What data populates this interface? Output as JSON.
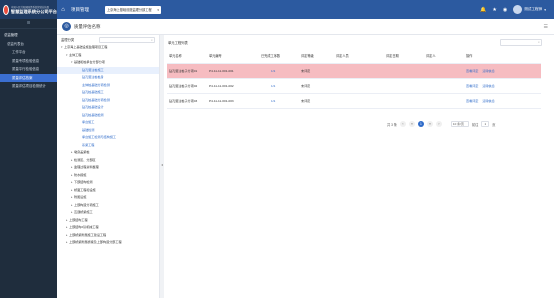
{
  "brand": {
    "subtitle": "中国人民共和国国资委监管营业执照",
    "title": "智慧监理系统分公司平台"
  },
  "sidebar": {
    "collapse_icon": "collapse-icon",
    "items": [
      {
        "label": "总监管理",
        "level": "l1"
      },
      {
        "label": "总监代表台",
        "level": "l2"
      },
      {
        "label": "工作平台",
        "level": "l3"
      },
      {
        "label": "质量专项检验信息",
        "level": "l3"
      },
      {
        "label": "质量平行检验信息",
        "level": "l3"
      },
      {
        "label": "质量评估档案",
        "level": "l3",
        "active": true
      },
      {
        "label": "质量评估项目检测统计",
        "level": "l3"
      }
    ]
  },
  "topbar": {
    "title": "项目管理",
    "project": "上京海上基础设施监理分部工程"
  },
  "page": {
    "title": "质量评估名称"
  },
  "tree": {
    "label": "监理分类",
    "nodes": [
      {
        "text": "上京海上基础设施监理项目工程",
        "indent": 4,
        "caret": "▾"
      },
      {
        "text": "主体工程",
        "indent": 9,
        "caret": "▾"
      },
      {
        "text": "基础和桩承台分部分项",
        "indent": 14,
        "caret": "▾"
      },
      {
        "text": "钻孔灌注桩施工",
        "indent": 22,
        "caret": "",
        "link": true,
        "selected": true
      },
      {
        "text": "钻孔灌注桩桩身",
        "indent": 22,
        "caret": "",
        "link": true
      },
      {
        "text": "主体桩基础分项检测",
        "indent": 22,
        "caret": "",
        "link": true
      },
      {
        "text": "钻孔桩基础施工",
        "indent": 22,
        "caret": "",
        "link": true
      },
      {
        "text": "钻孔桩基础分项检测",
        "indent": 22,
        "caret": "",
        "link": true
      },
      {
        "text": "钻孔桩基础设计",
        "indent": 22,
        "caret": "",
        "link": true
      },
      {
        "text": "钻孔桩基础检测",
        "indent": 22,
        "caret": "",
        "link": true
      },
      {
        "text": "承台施工",
        "indent": 22,
        "caret": "",
        "link": true
      },
      {
        "text": "基础检测",
        "indent": 22,
        "caret": "",
        "link": true
      },
      {
        "text": "承台施工检测与结构施工",
        "indent": 22,
        "caret": "",
        "link": true
      },
      {
        "text": "系梁工程",
        "indent": 22,
        "caret": "",
        "link": true
      },
      {
        "text": "墩身盖梁桩",
        "indent": 14,
        "caret": "▸"
      },
      {
        "text": "检测区、分部区",
        "indent": 14,
        "caret": "▸"
      },
      {
        "text": "监理过程资料整理",
        "indent": 14,
        "caret": "▸"
      },
      {
        "text": "防水措施",
        "indent": 14,
        "caret": "▸"
      },
      {
        "text": "下部结构检测",
        "indent": 14,
        "caret": "▸"
      },
      {
        "text": "桥面工程和设施",
        "indent": 14,
        "caret": "▸"
      },
      {
        "text": "附属设施",
        "indent": 14,
        "caret": "▸"
      },
      {
        "text": "上部构造分项施工",
        "indent": 14,
        "caret": "▸"
      },
      {
        "text": "互通桥梁施工",
        "indent": 14,
        "caret": "▸"
      },
      {
        "text": "上部结构工程",
        "indent": 9,
        "caret": "▸"
      },
      {
        "text": "上部结构2队机械工程",
        "indent": 9,
        "caret": "▸"
      },
      {
        "text": "上部桥梁附属施工建设工程",
        "indent": 9,
        "caret": "▸"
      },
      {
        "text": "上部桥梁附属桥梁及上部构造分部工程",
        "indent": 9,
        "caret": "▸"
      }
    ]
  },
  "main": {
    "label": "单元工程列表",
    "columns": [
      "单元名称",
      "单元编号",
      "已完成工序数",
      "评定等级",
      "评定人员",
      "评定日期",
      "评定人",
      "操作"
    ],
    "rows": [
      {
        "name": "钻孔灌注桩子分项01",
        "code": "P4-11-11-001-001",
        "count": "1/1",
        "grade": "未评定",
        "person": "",
        "date": "",
        "rater": "",
        "op1": "查看评定",
        "op2": "清除信息",
        "highlight": true
      },
      {
        "name": "钻孔灌注桩子分项02",
        "code": "P4-11-11-001-002",
        "count": "1/1",
        "grade": "未评定",
        "person": "",
        "date": "",
        "rater": "",
        "op1": "查看评定",
        "op2": "清除信息",
        "highlight": false
      },
      {
        "name": "钻孔灌注桩子分项03",
        "code": "P4-11-11-001-003",
        "count": "1/1",
        "grade": "未评定",
        "person": "",
        "date": "",
        "rater": "",
        "op1": "查看评定",
        "op2": "清除信息",
        "highlight": false
      }
    ]
  },
  "pager": {
    "total": "共 3 条",
    "current": "1",
    "size": "10 条/页",
    "goto_label": "前往",
    "goto_value": "1",
    "page_suffix": "页"
  },
  "user": {
    "name": "测试工程师"
  },
  "colors": {
    "sidebar": "#1f2d3d",
    "topbar": "#2c5aa0",
    "active": "#3b6fd1",
    "highlight_row": "#f6bcc1"
  }
}
